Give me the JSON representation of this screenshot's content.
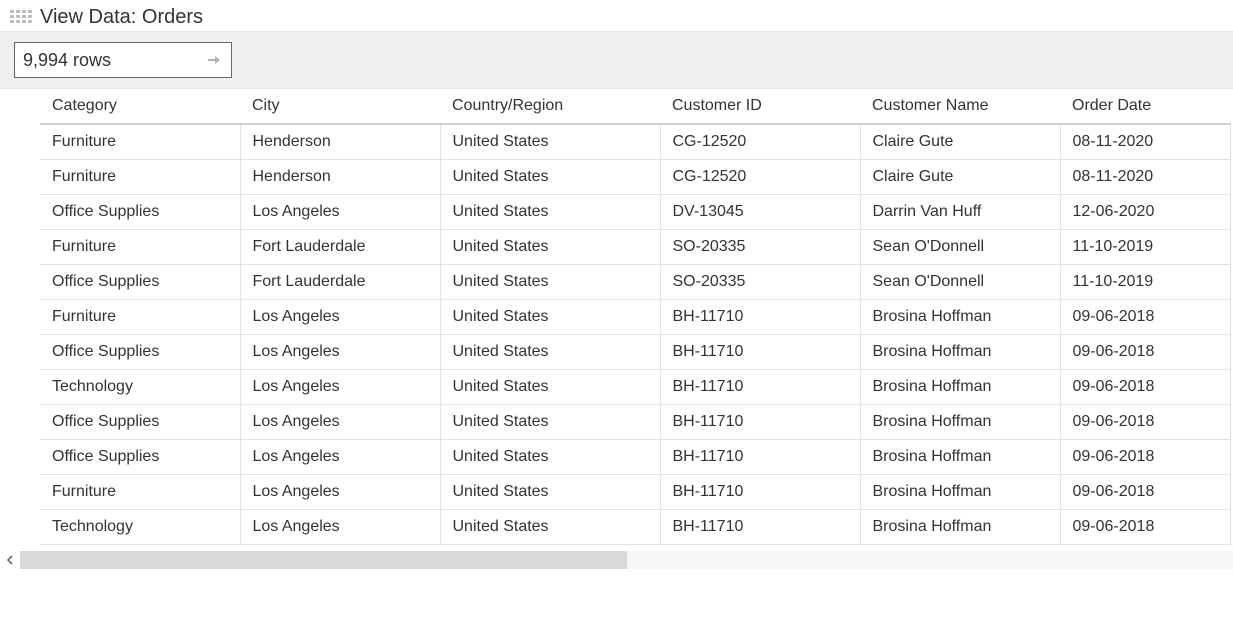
{
  "header": {
    "title": "View Data: Orders"
  },
  "toolbar": {
    "row_count_label": "9,994 rows"
  },
  "table": {
    "columns": [
      "Category",
      "City",
      "Country/Region",
      "Customer ID",
      "Customer Name",
      "Order Date"
    ],
    "rows": [
      {
        "category": "Furniture",
        "city": "Henderson",
        "country": "United States",
        "customer_id": "CG-12520",
        "customer_name": "Claire Gute",
        "order_date": "08-11-2020"
      },
      {
        "category": "Furniture",
        "city": "Henderson",
        "country": "United States",
        "customer_id": "CG-12520",
        "customer_name": "Claire Gute",
        "order_date": "08-11-2020"
      },
      {
        "category": "Office Supplies",
        "city": "Los Angeles",
        "country": "United States",
        "customer_id": "DV-13045",
        "customer_name": "Darrin Van Huff",
        "order_date": "12-06-2020"
      },
      {
        "category": "Furniture",
        "city": "Fort Lauderdale",
        "country": "United States",
        "customer_id": "SO-20335",
        "customer_name": "Sean O'Donnell",
        "order_date": "11-10-2019"
      },
      {
        "category": "Office Supplies",
        "city": "Fort Lauderdale",
        "country": "United States",
        "customer_id": "SO-20335",
        "customer_name": "Sean O'Donnell",
        "order_date": "11-10-2019"
      },
      {
        "category": "Furniture",
        "city": "Los Angeles",
        "country": "United States",
        "customer_id": "BH-11710",
        "customer_name": "Brosina Hoffman",
        "order_date": "09-06-2018"
      },
      {
        "category": "Office Supplies",
        "city": "Los Angeles",
        "country": "United States",
        "customer_id": "BH-11710",
        "customer_name": "Brosina Hoffman",
        "order_date": "09-06-2018"
      },
      {
        "category": "Technology",
        "city": "Los Angeles",
        "country": "United States",
        "customer_id": "BH-11710",
        "customer_name": "Brosina Hoffman",
        "order_date": "09-06-2018"
      },
      {
        "category": "Office Supplies",
        "city": "Los Angeles",
        "country": "United States",
        "customer_id": "BH-11710",
        "customer_name": "Brosina Hoffman",
        "order_date": "09-06-2018"
      },
      {
        "category": "Office Supplies",
        "city": "Los Angeles",
        "country": "United States",
        "customer_id": "BH-11710",
        "customer_name": "Brosina Hoffman",
        "order_date": "09-06-2018"
      },
      {
        "category": "Furniture",
        "city": "Los Angeles",
        "country": "United States",
        "customer_id": "BH-11710",
        "customer_name": "Brosina Hoffman",
        "order_date": "09-06-2018"
      },
      {
        "category": "Technology",
        "city": "Los Angeles",
        "country": "United States",
        "customer_id": "BH-11710",
        "customer_name": "Brosina Hoffman",
        "order_date": "09-06-2018"
      }
    ]
  }
}
